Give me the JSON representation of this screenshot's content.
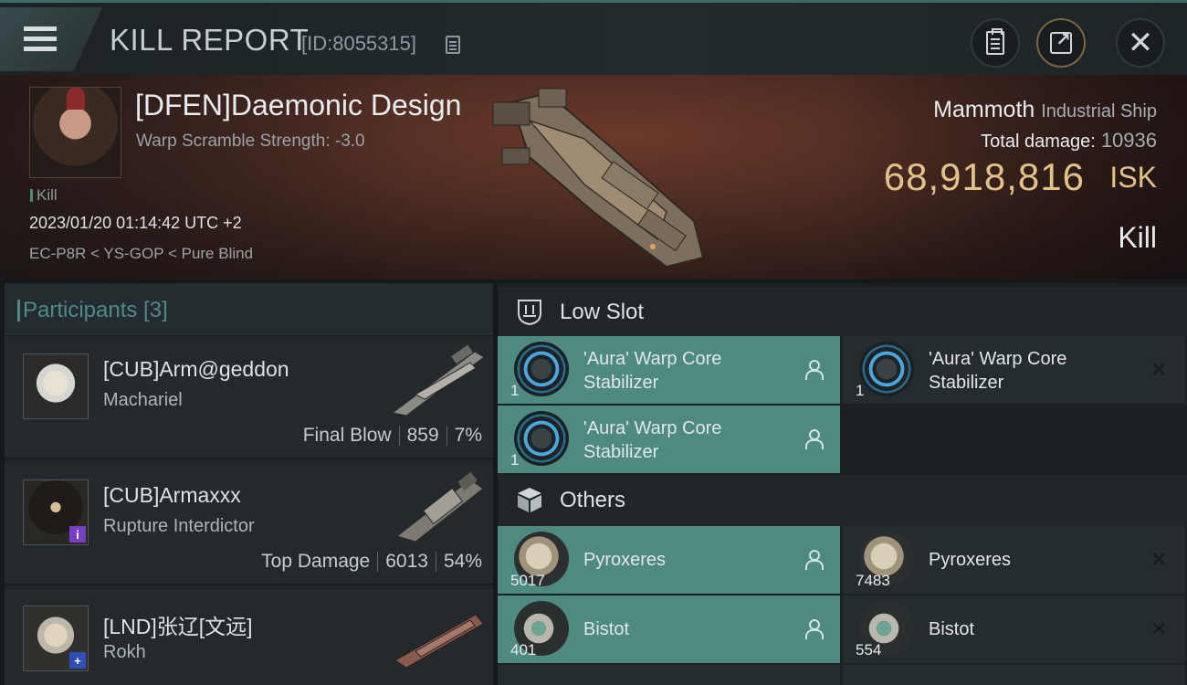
{
  "header": {
    "title": "KILL REPORT",
    "report_id": "[ID:8055315]"
  },
  "victim": {
    "name": "[DFEN]Daemonic Design",
    "warp_scramble": "Warp Scramble Strength: -3.0",
    "tag": "Kill",
    "datetime": "2023/01/20 01:14:42 UTC +2",
    "location": "EC-P8R < YS-GOP < Pure Blind",
    "ship": "Mammoth",
    "ship_category": "Industrial Ship",
    "total_damage_label": "Total damage:",
    "total_damage": "10936",
    "isk_value": "68,918,816",
    "isk_unit": "ISK",
    "result": "Kill"
  },
  "participants": {
    "title": "Participants [3]",
    "list": [
      {
        "name": "[CUB]Arm@geddon",
        "ship": "Machariel",
        "role": "Final Blow",
        "damage": "859",
        "percent": "7%"
      },
      {
        "name": "[CUB]Armaxxx",
        "ship": "Rupture Interdictor",
        "role": "Top Damage",
        "damage": "6013",
        "percent": "54%",
        "badge": "i"
      },
      {
        "name": "[LND]张辽[文远]",
        "ship": "Rokh",
        "badge": "+"
      }
    ]
  },
  "low_slot": {
    "title": "Low Slot",
    "items": [
      {
        "name": "'Aura' Warp Core Stabilizer",
        "qty": "1",
        "status": "dropped"
      },
      {
        "name": "'Aura' Warp Core Stabilizer",
        "qty": "1",
        "status": "destroyed"
      },
      {
        "name": "'Aura' Warp Core Stabilizer",
        "qty": "1",
        "status": "dropped"
      }
    ]
  },
  "others": {
    "title": "Others",
    "items": [
      {
        "name": "Pyroxeres",
        "qty": "5017",
        "status": "dropped"
      },
      {
        "name": "Pyroxeres",
        "qty": "7483",
        "status": "destroyed"
      },
      {
        "name": "Bistot",
        "qty": "401",
        "status": "dropped"
      },
      {
        "name": "Bistot",
        "qty": "554",
        "status": "destroyed"
      }
    ]
  },
  "colors": {
    "accent_teal": "#4f8a80",
    "isk_gold": "#e3c28a",
    "panel_dark": "#1b2023"
  },
  "icons": [
    "menu-icon",
    "copy-icon",
    "clipboard-icon",
    "share-icon",
    "close-icon",
    "low-slot-icon",
    "cargo-box-icon",
    "person-icon",
    "x-icon"
  ]
}
